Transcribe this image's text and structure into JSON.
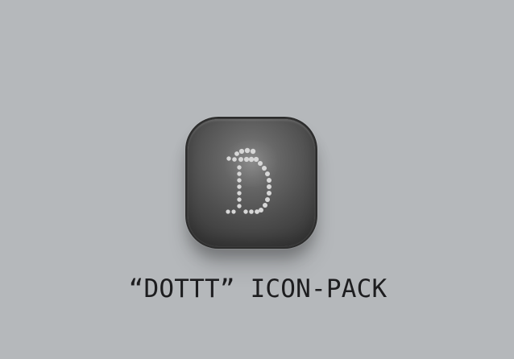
{
  "brand": {
    "icon_name": "dotted-d-icon",
    "background_color": "#b5b8bb",
    "icon_base_color": "#4f4f4f",
    "dot_color": "#d7d7d7"
  },
  "caption": {
    "text": "“DOTTT” ICON-PACK"
  }
}
